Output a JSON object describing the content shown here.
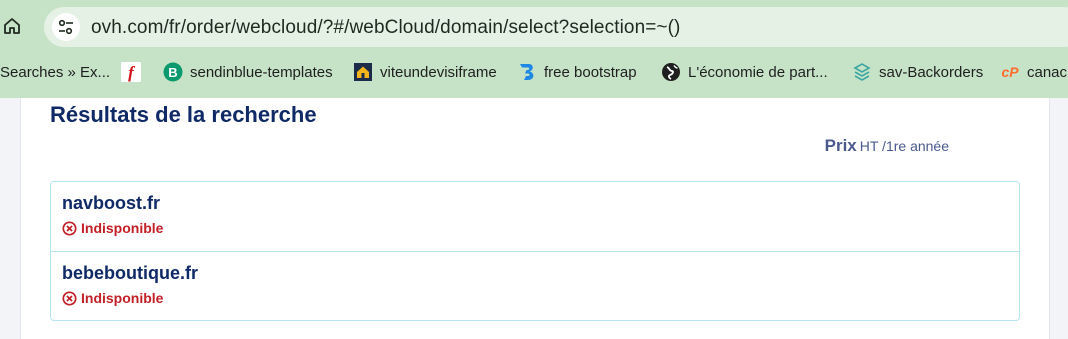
{
  "browser": {
    "url": "ovh.com/fr/order/webcloud/?#/webCloud/domain/select?selection=~()",
    "bookmarks": [
      {
        "label": "Searches » Ex...",
        "icon": "none"
      },
      {
        "label": "",
        "icon": "f-logo-icon"
      },
      {
        "label": "sendinblue-templates",
        "icon": "b-logo-icon"
      },
      {
        "label": "viteundevisiframe",
        "icon": "house-logo-icon"
      },
      {
        "label": "free bootstrap",
        "icon": "bootstrap-logo-icon"
      },
      {
        "label": "L'économie de part...",
        "icon": "globe-icon"
      },
      {
        "label": "sav-Backorders",
        "icon": "layers-logo-icon"
      },
      {
        "label": "canac",
        "icon": "cpanel-logo-icon"
      }
    ]
  },
  "page": {
    "title": "Résultats de la recherche",
    "price_label": "Prix",
    "price_sub": "HT /1re année",
    "results": [
      {
        "domain": "navboost.fr",
        "status": "Indisponible"
      },
      {
        "domain": "bebeboutique.fr",
        "status": "Indisponible"
      }
    ]
  },
  "colors": {
    "chrome_bg": "#c6e3c8",
    "heading": "#0f2a66",
    "unavailable": "#c21f26",
    "border": "#b8e4ef"
  }
}
